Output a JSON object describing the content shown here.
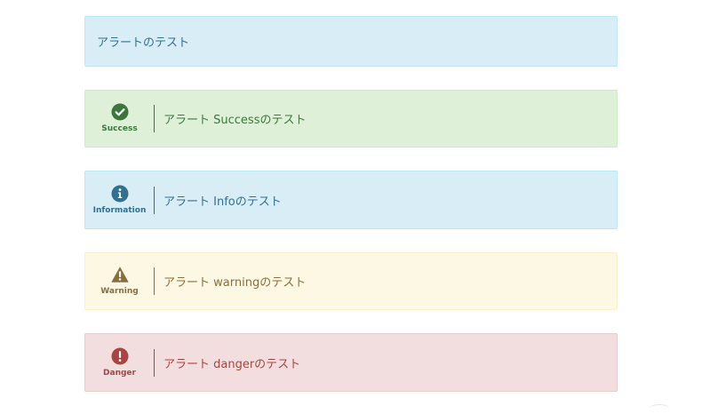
{
  "alerts": {
    "plain": {
      "text": "アラートのテスト",
      "color": "#31708f",
      "bg": "#d9edf7"
    },
    "success": {
      "label": "Success",
      "text": "アラート Successのテスト",
      "icon": "check-circle-icon",
      "color": "#3c763d",
      "bg": "#dff0d8"
    },
    "info": {
      "label": "Information",
      "text": "アラート Infoのテスト",
      "icon": "info-circle-icon",
      "color": "#31708f",
      "bg": "#d9edf7"
    },
    "warning": {
      "label": "Warning",
      "text": "アラート warningのテスト",
      "icon": "warning-triangle-icon",
      "color": "#8a6d3b",
      "bg": "#fcf8e3"
    },
    "danger": {
      "label": "Danger",
      "text": "アラート dangerのテスト",
      "icon": "exclamation-circle-icon",
      "color": "#a94442",
      "bg": "#f2dede"
    }
  }
}
